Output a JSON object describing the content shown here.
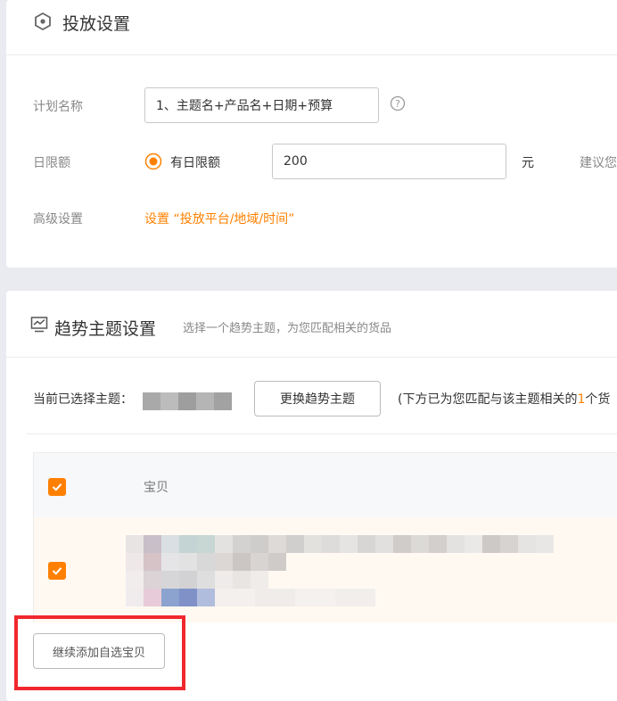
{
  "placement": {
    "title": "投放设置",
    "plan_name_label": "计划名称",
    "plan_name_value": "1、主题名+产品名+日期+预算",
    "daily_limit_label": "日限额",
    "daily_limit_option": "有日限额",
    "daily_limit_value": "200",
    "unit": "元",
    "suggestion_text": "建议您",
    "advanced_label": "高级设置",
    "advanced_link": "设置 “投放平台/地域/时间”"
  },
  "trend": {
    "title": "趋势主题设置",
    "subtitle": "选择一个趋势主题，为您匹配相关的货品",
    "current_label": "当前已选择主题：",
    "change_button": "更换趋势主题",
    "match_note_prefix": "(下方已为您匹配与该主题相关的",
    "match_note_count": "1",
    "match_note_suffix": "个货",
    "table_header_item": "宝贝",
    "add_button": "继续添加自选宝贝"
  },
  "colors": {
    "accent": "#ff8000",
    "highlight_box": "#f0282d",
    "row_highlight": "#fff9f2"
  }
}
